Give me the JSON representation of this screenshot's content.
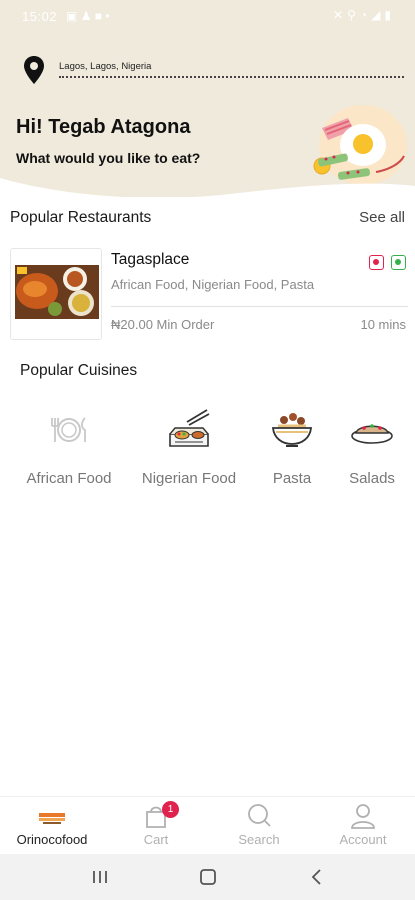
{
  "status_bar": {
    "time": "15:02",
    "left_icons": [
      "image-icon",
      "person-icon",
      "video-icon",
      "dot-icon"
    ],
    "right_icons": [
      "mute-icon",
      "location-icon",
      "wifi-icon",
      "signal-icon",
      "battery-icon"
    ]
  },
  "header": {
    "location": "Lagos, Lagos, Nigeria",
    "greeting": "Hi! Tegab Atagona",
    "prompt": "What would you like to eat?"
  },
  "popular_restaurants": {
    "title": "Popular Restaurants",
    "see_all": "See all",
    "items": [
      {
        "name": "Tagasplace",
        "tags": "African Food, Nigerian Food, Pasta",
        "min_order": "₦20.00 Min Order",
        "delivery_time": "10 mins",
        "status_colors": [
          "#e0234e",
          "#35b04a"
        ]
      }
    ]
  },
  "popular_cuisines": {
    "title": "Popular Cuisines",
    "items": [
      {
        "label": "African Food",
        "icon": "plate-cutlery-icon"
      },
      {
        "label": "Nigerian Food",
        "icon": "meal-tray-icon"
      },
      {
        "label": "Pasta",
        "icon": "pasta-bowl-icon"
      },
      {
        "label": "Salads",
        "icon": "salad-plate-icon"
      }
    ]
  },
  "bottom_nav": {
    "items": [
      {
        "label": "Orinocofood",
        "icon": "orinocofood-logo-icon",
        "active": true
      },
      {
        "label": "Cart",
        "icon": "cart-icon",
        "badge": "1"
      },
      {
        "label": "Search",
        "icon": "search-icon"
      },
      {
        "label": "Account",
        "icon": "account-icon"
      }
    ]
  },
  "colors": {
    "header_bg": "#efeadc",
    "accent_red": "#e0234e",
    "accent_green": "#35b04a"
  }
}
